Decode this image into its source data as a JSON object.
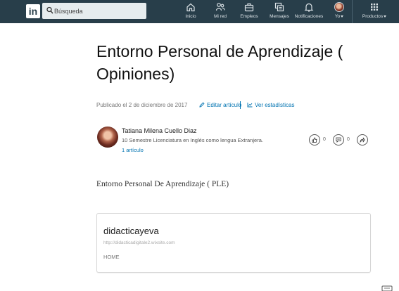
{
  "nav": {
    "logo": "in",
    "search_placeholder": "Búsqueda",
    "items": [
      {
        "label": "Inicio",
        "icon": "home-icon"
      },
      {
        "label": "Mi red",
        "icon": "network-icon"
      },
      {
        "label": "Empleos",
        "icon": "briefcase-icon"
      },
      {
        "label": "Mensajes",
        "icon": "messages-icon"
      },
      {
        "label": "Notificaciones",
        "icon": "bell-icon"
      },
      {
        "label": "Yo",
        "icon": "avatar"
      },
      {
        "label": "Productos",
        "icon": "grid-icon"
      }
    ]
  },
  "article": {
    "title": "Entorno Personal de Aprendizaje ( Opiniones)",
    "published": "Publicado el 2 de diciembre de 2017",
    "edit_label": "Editar artículo",
    "stats_label": "Ver estadísticas",
    "author": {
      "name": "Tatiana Milena Cuello Diaz",
      "bio": "10 Semestre Licenciatura en Inglés como lengua Extranjera.",
      "articles": "1 artículo"
    },
    "actions": {
      "likes": "0",
      "comments": "0"
    },
    "body": "Entorno Personal De Aprendizaje ( PLE)",
    "embed": {
      "title": "didacticayeva",
      "url": "http://didacticadigitale2.wixsite.com",
      "subtitle": "HOME"
    }
  },
  "colors": {
    "nav_bg": "#283e4a",
    "link": "#0073b1"
  }
}
